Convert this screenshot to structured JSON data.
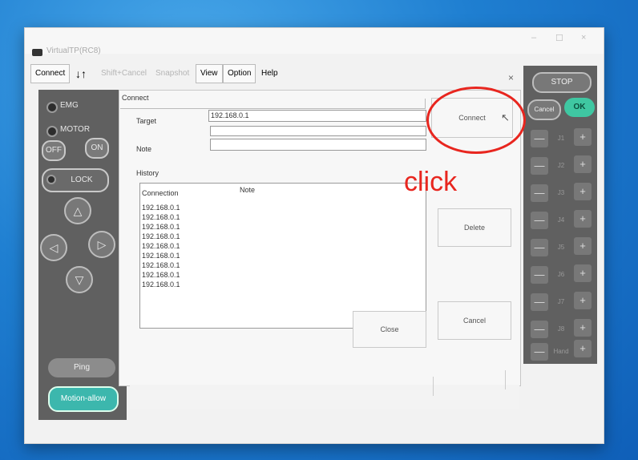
{
  "app": {
    "title": "VirtualTP(RC8)"
  },
  "window_controls": {
    "minimize": "–",
    "maximize": "☐",
    "close": "×"
  },
  "menu": {
    "connect": "Connect",
    "sort": "↓↑",
    "shift_cancel": "Shift+Cancel",
    "snapshot": "Snapshot",
    "view": "View",
    "option": "Option",
    "help": "Help"
  },
  "left_panel": {
    "emg": "EMG",
    "motor": "MOTOR",
    "off": "OFF",
    "on": "ON",
    "lock": "LOCK",
    "up": "△",
    "left": "◁",
    "right": "▷",
    "down": "▽",
    "ping": "Ping",
    "motion_allow": "Motion-allow"
  },
  "right_panel": {
    "stop": "STOP",
    "cancel": "Cancel",
    "ok": "OK",
    "minus": "—",
    "plus": "+",
    "joints": [
      "J1",
      "J2",
      "J3",
      "J4",
      "J5",
      "J6",
      "J7",
      "J8",
      "Hand"
    ]
  },
  "dialog": {
    "group_title": "Connect",
    "close_x": "×",
    "target_label": "Target",
    "target_value": "192.168.0.1",
    "note_label": "Note",
    "note_value": "",
    "history_label": "History",
    "col_connection": "Connection",
    "col_note": "Note",
    "history": [
      "192.168.0.1",
      "192.168.0.1",
      "192.168.0.1",
      "192.168.0.1",
      "192.168.0.1",
      "192.168.0.1",
      "192.168.0.1",
      "192.168.0.1",
      "192.168.0.1"
    ],
    "connect_button": "Connect",
    "delete_button": "Delete",
    "close_button": "Close",
    "cancel_button": "Cancel"
  },
  "annotation": {
    "text": "click",
    "color": "#e8261f"
  },
  "colors": {
    "ok_green": "#3fc7a2",
    "motion_teal": "#3cb7ad",
    "panel_gray": "#606060",
    "desktop_blue": "#1f7fd1"
  }
}
